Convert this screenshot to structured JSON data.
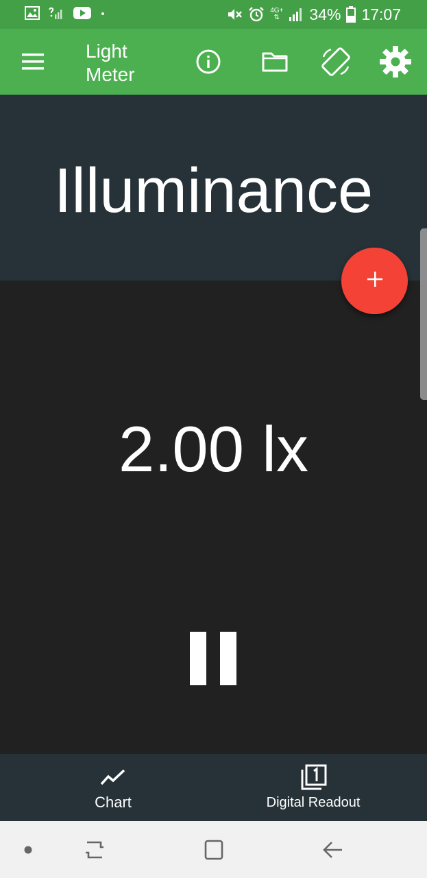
{
  "status_bar": {
    "left_icons": [
      "image-icon",
      "no-signal-icon",
      "youtube-icon",
      "dot-icon"
    ],
    "right_icons": [
      "mute-icon",
      "alarm-icon",
      "lte-icon",
      "signal-icon"
    ],
    "network": "4G+",
    "battery": "34%",
    "time": "17:07",
    "color": "#43a047"
  },
  "app_bar": {
    "title": "Light Meter",
    "icons": [
      "menu-icon",
      "info-icon",
      "folder-icon",
      "screen-rotate-icon",
      "settings-icon"
    ],
    "color": "#4caf50"
  },
  "sensor": {
    "title": "Illuminance",
    "reading": "2.00 lx",
    "panel_color": "#263238",
    "body_color": "#212121"
  },
  "fab": {
    "icon": "plus-icon",
    "color": "#f44336"
  },
  "controls": {
    "pause_icon": "pause-icon"
  },
  "bottom_nav": {
    "tabs": [
      {
        "label": "Chart",
        "icon": "chart-line-icon"
      },
      {
        "label": "Digital Readout",
        "icon": "digital-readout-icon"
      }
    ]
  },
  "system_nav": {
    "buttons": [
      "dot-icon",
      "recent-apps-icon",
      "home-icon",
      "back-icon"
    ]
  }
}
